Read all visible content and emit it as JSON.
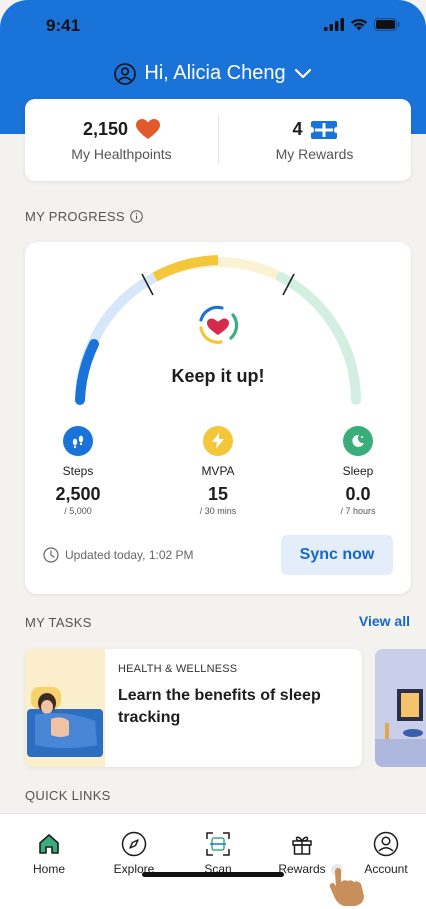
{
  "status": {
    "time": "9:41"
  },
  "greeting": {
    "text": "Hi, Alicia Cheng"
  },
  "summary": {
    "healthpoints_value": "2,150",
    "healthpoints_label": "My Healthpoints",
    "rewards_value": "4",
    "rewards_label": "My Rewards"
  },
  "progress": {
    "section_title": "MY PROGRESS",
    "message": "Keep it up!",
    "metrics": [
      {
        "name": "Steps",
        "value": "2,500",
        "goal": "/ 5,000",
        "progress": 0.5,
        "color": "#1a73d9"
      },
      {
        "name": "MVPA",
        "value": "15",
        "goal": "/ 30 mins",
        "progress": 0.5,
        "color": "#f4c63a"
      },
      {
        "name": "Sleep",
        "value": "0.0",
        "goal": "/ 7 hours",
        "progress": 0.0,
        "color": "#3aae7a"
      }
    ],
    "updated_text": "Updated today, 1:02 PM",
    "sync_label": "Sync now"
  },
  "tasks": {
    "section_title": "MY TASKS",
    "view_all_label": "View all",
    "items": [
      {
        "category": "HEALTH & WELLNESS",
        "title": "Learn the benefits of sleep tracking"
      }
    ]
  },
  "quick_links": {
    "section_title": "QUICK LINKS"
  },
  "tab_bar": {
    "items": [
      {
        "label": "Home",
        "icon": "home-icon"
      },
      {
        "label": "Explore",
        "icon": "compass-icon"
      },
      {
        "label": "Scan",
        "icon": "scan-icon"
      },
      {
        "label": "Rewards",
        "icon": "gift-icon"
      },
      {
        "label": "Account",
        "icon": "account-icon"
      }
    ]
  },
  "colors": {
    "brand_blue": "#1a73d9",
    "accent_yellow": "#f4c63a",
    "accent_green": "#3aae7a",
    "heart_orange": "#e25a2c"
  }
}
